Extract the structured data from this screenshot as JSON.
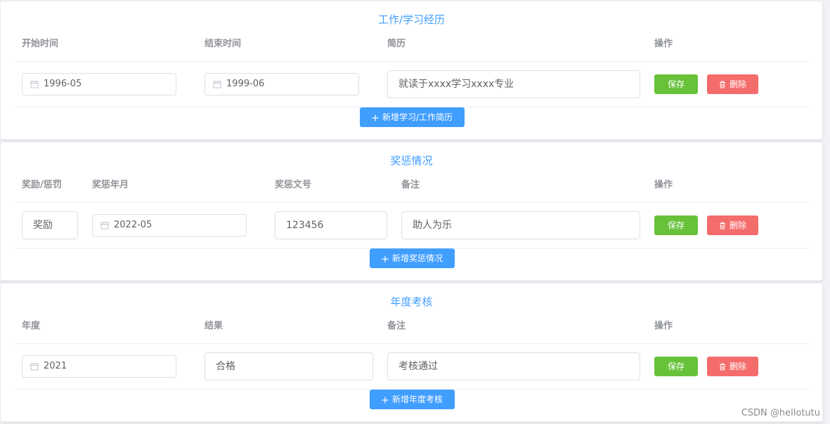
{
  "work": {
    "title": "工作/学习经历",
    "headers": {
      "start": "开始时间",
      "end": "结束时间",
      "resume": "简历",
      "action": "操作"
    },
    "row": {
      "start": "1996-05",
      "end": "1999-06",
      "resume": "就读于xxxx学习xxxx专业"
    },
    "save_label": "保存",
    "delete_label": "删除",
    "add_label": "新增学习/工作简历"
  },
  "awards": {
    "title": "奖惩情况",
    "headers": {
      "type": "奖励/惩罚",
      "date": "奖惩年月",
      "doc_no": "奖惩文号",
      "remark": "备注",
      "action": "操作"
    },
    "row": {
      "type": "奖励",
      "date": "2022-05",
      "doc_no": "123456",
      "remark": "助人为乐"
    },
    "save_label": "保存",
    "delete_label": "删除",
    "add_label": "新增奖惩情况"
  },
  "annual": {
    "title": "年度考核",
    "headers": {
      "year": "年度",
      "result": "结果",
      "remark": "备注",
      "action": "操作"
    },
    "row": {
      "year": "2021",
      "result": "合格",
      "remark": "考核通过"
    },
    "save_label": "保存",
    "delete_label": "删除",
    "add_label": "新增年度考核"
  },
  "watermark": "CSDN @hellotutu",
  "colors": {
    "primary": "#409eff",
    "success": "#67c23a",
    "danger": "#f56c6c",
    "header_text": "#909399"
  },
  "icons": {
    "date": "calendar-icon",
    "delete": "trash-icon",
    "add": "plus-icon"
  }
}
